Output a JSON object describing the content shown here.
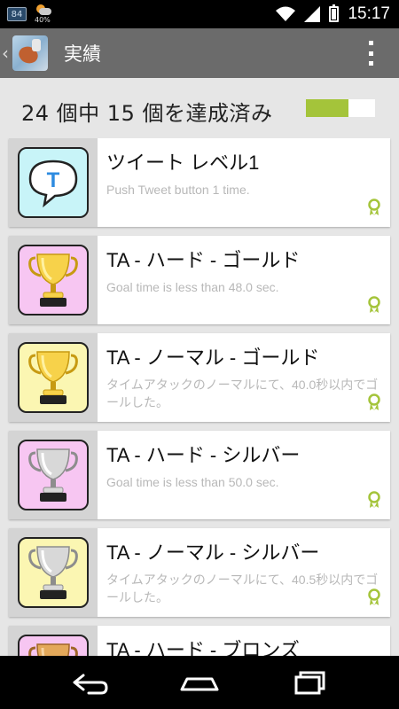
{
  "status_bar": {
    "notification_badge": "84",
    "weather_percent": "40%",
    "time": "15:17"
  },
  "action_bar": {
    "title": "実績"
  },
  "summary": {
    "text": "24 個中 15 個を達成済み",
    "progress_label": "62%",
    "progress_fraction": 0.62
  },
  "achievements": [
    {
      "title": "ツイート レベル1",
      "description": "Push Tweet button 1 time.",
      "icon": "tweet-bubble-icon",
      "tile_color": "#c8f4f8"
    },
    {
      "title": "TA - ハード - ゴールド",
      "description": "Goal time is less than 48.0 sec.",
      "icon": "gold-trophy-icon",
      "tile_color": "#f7c6f2"
    },
    {
      "title": "TA - ノーマル - ゴールド",
      "description": "タイムアタックのノーマルにて、40.0秒以内でゴールした。",
      "icon": "gold-trophy-icon",
      "tile_color": "#fbf6b2"
    },
    {
      "title": "TA - ハード - シルバー",
      "description": "Goal time is less than 50.0 sec.",
      "icon": "silver-trophy-icon",
      "tile_color": "#f7c6f2"
    },
    {
      "title": "TA - ノーマル - シルバー",
      "description": "タイムアタックのノーマルにて、40.5秒以内でゴールした。",
      "icon": "silver-trophy-icon",
      "tile_color": "#fbf6b2"
    },
    {
      "title": "TA - ハード - ブロンズ",
      "description": "",
      "icon": "bronze-trophy-icon",
      "tile_color": "#f7c6f2"
    }
  ],
  "colors": {
    "progress_fill": "#a4c43a",
    "action_bar": "#6b6b6b",
    "ribbon": "#a4c43a"
  }
}
